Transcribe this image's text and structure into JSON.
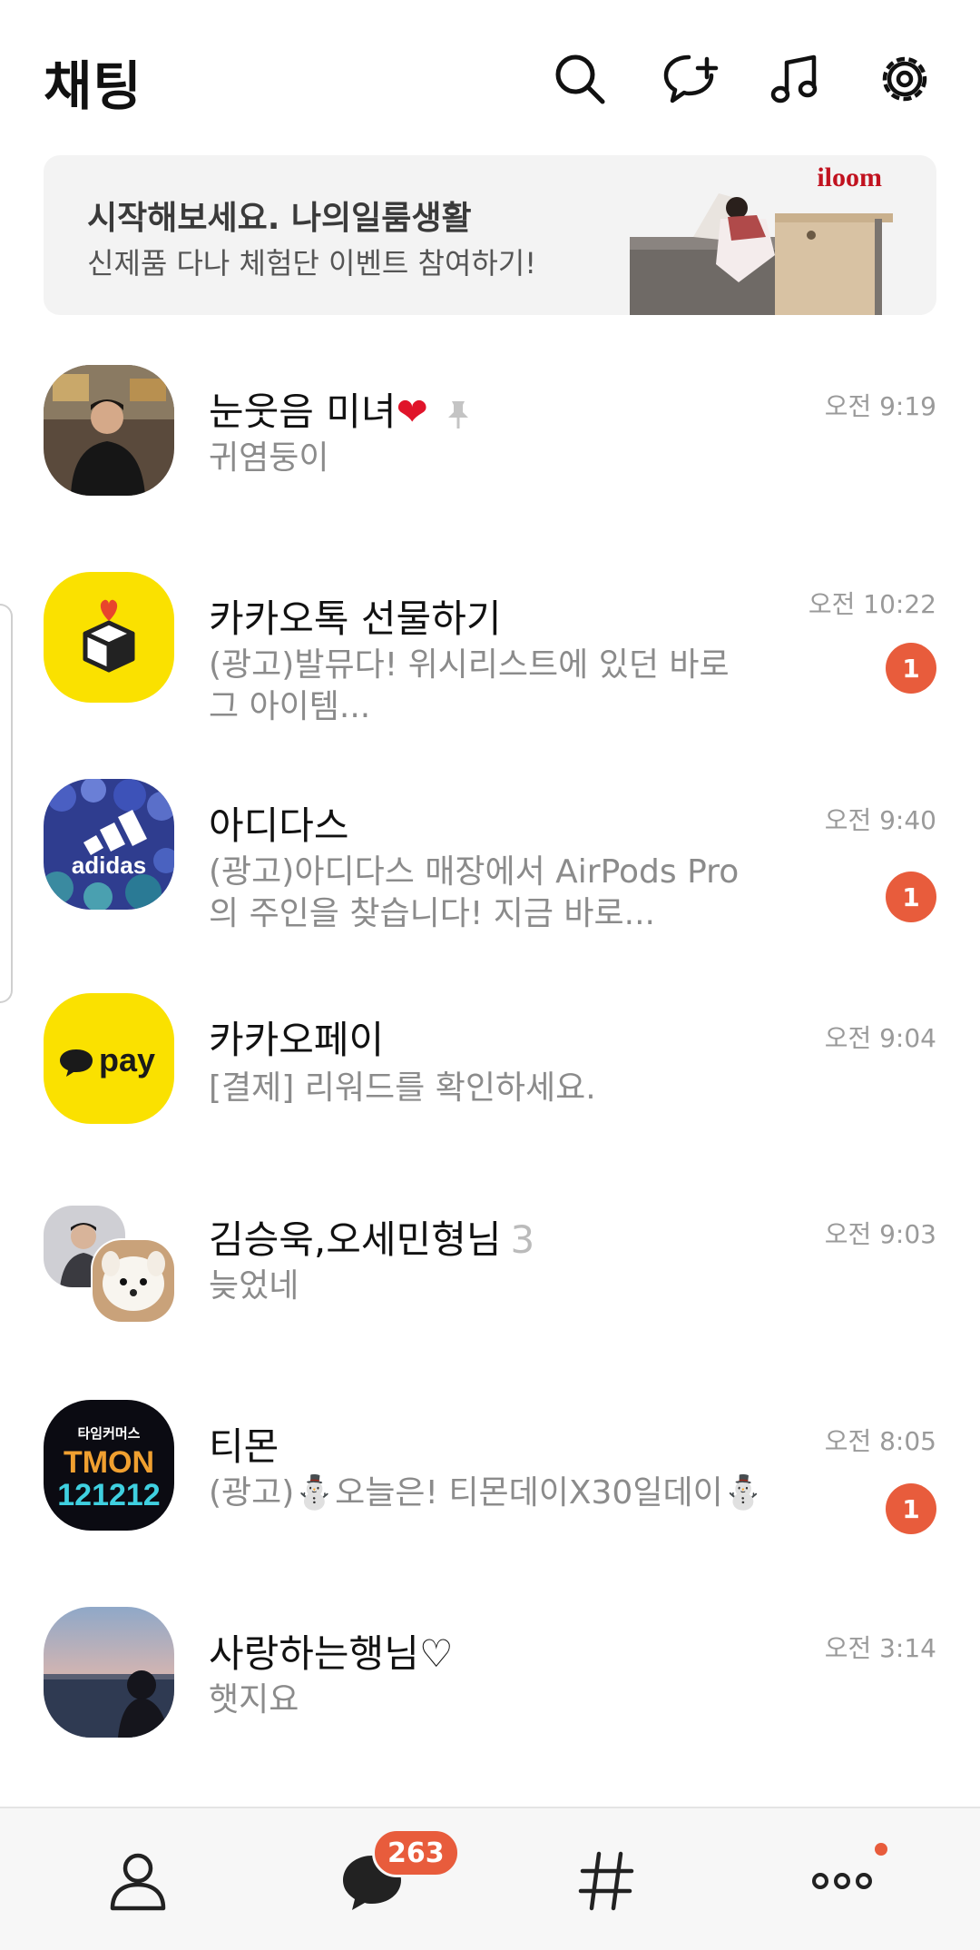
{
  "header": {
    "title": "채팅",
    "icons": [
      "search-icon",
      "new-chat-icon",
      "music-icon",
      "settings-icon"
    ]
  },
  "banner": {
    "title": "시작해보세요. 나의일룸생활",
    "subtitle": "신제품 다나 체험단 이벤트 참여하기!",
    "brand": "iloom"
  },
  "chats": [
    {
      "name": "눈웃음 미녀",
      "emoji": "❤",
      "pinned": true,
      "message": "귀염둥이",
      "time": "오전 9:19",
      "badge": ""
    },
    {
      "name": "카카오톡 선물하기",
      "message": "(광고)발뮤다! 위시리스트에 있던 바로 그 아이템...",
      "time": "오전 10:22",
      "badge": "1"
    },
    {
      "name": "아디다스",
      "message": "(광고)아디다스 매장에서 AirPods Pro의 주인을 찾습니다! 지금 바로...",
      "time": "오전 9:40",
      "badge": "1",
      "avatar_text": "adidas"
    },
    {
      "name": "카카오페이",
      "message": "[결제] 리워드를 확인하세요.",
      "time": "오전 9:04",
      "badge": "",
      "avatar_text": "pay"
    },
    {
      "name": "김승욱,오세민형님",
      "member_count": "3",
      "message": "늦었네",
      "time": "오전 9:03",
      "badge": ""
    },
    {
      "name": "티몬",
      "message": "(광고)⛄오늘은! 티몬데이X30일데이⛄",
      "time": "오전 8:05",
      "badge": "1",
      "avatar_text_top": "타임커머스",
      "avatar_text_mid": "TMON",
      "avatar_text_bottom": "121212"
    },
    {
      "name": "사랑하는행님♡",
      "message": "햇지요",
      "time": "오전 3:14",
      "badge": ""
    }
  ],
  "bottom_nav": {
    "items": [
      "friends-icon",
      "chats-icon",
      "openchat-hash-icon",
      "more-icon"
    ],
    "chat_badge": "263",
    "colors": {
      "badge": "#e85c3c",
      "kakao_yellow": "#fae100"
    }
  }
}
